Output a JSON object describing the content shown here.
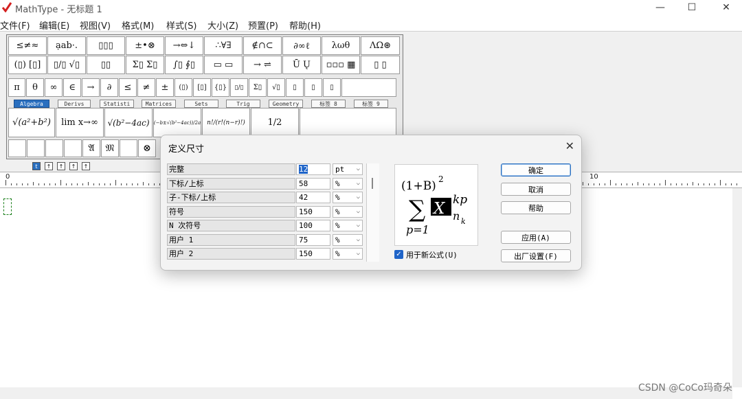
{
  "window": {
    "title": "MathType - 无标题 1",
    "minimize_glyph": "—",
    "maximize_glyph": "☐",
    "close_glyph": "✕"
  },
  "menu": [
    "文件(F)",
    "编辑(E)",
    "视图(V)",
    "格式(M)",
    "样式(S)",
    "大小(Z)",
    "预置(P)",
    "帮助(H)"
  ],
  "palette": {
    "row1": [
      "≤≠≈",
      "ạab·.",
      "▯▯▯",
      "±•⊗",
      "→⇔↓",
      "∴∀∃",
      "∉∩⊂",
      "∂∞ℓ",
      "λωθ",
      "ΛΩ⊛"
    ],
    "row2": [
      "(▯) [▯]",
      "▯/▯ √▯",
      "▯▯",
      "Σ▯ Σ▯",
      "∫▯ ∮▯",
      "▭ ▭",
      "→ ⇌",
      "Ū Ų",
      "▫▫▫ ▦",
      "▯ ▯"
    ],
    "row3": [
      "π",
      "θ",
      "∞",
      "∈",
      "→",
      "∂",
      "≤",
      "≠",
      "±",
      "(▯)",
      "[▯]",
      "{▯}",
      "▯/▯",
      "Σ▯",
      "√▯",
      "▯",
      "▯",
      "▯"
    ],
    "tabs": [
      "Algebra",
      "Derivs",
      "Statisti",
      "Matrices",
      "Sets",
      "Trig",
      "Geometry",
      "标签 8",
      "标签 9"
    ],
    "templates": [
      "√(a²+b²)",
      "lim x→∞",
      "√(b²−4ac)",
      "(−b±√(b²−4ac))/2a",
      "n!/(r!(n−r)!)",
      "1/2"
    ],
    "row5": [
      "𝔄",
      "𝔐",
      "⊗"
    ],
    "nav": [
      "t",
      "↑",
      "↑",
      "↑",
      "↑"
    ]
  },
  "ruler": {
    "labels": [
      "0",
      "10"
    ]
  },
  "dialog": {
    "title": "定义尺寸",
    "close": "✕",
    "rows": [
      {
        "label": "完整",
        "value": "12",
        "unit": "pt"
      },
      {
        "label": "下标/上标",
        "value": "58",
        "unit": "%"
      },
      {
        "label": "子-下标/上标",
        "value": "42",
        "unit": "%"
      },
      {
        "label": "符号",
        "value": "150",
        "unit": "%"
      },
      {
        "label": "N 次符号",
        "value": "100",
        "unit": "%"
      },
      {
        "label": "用户 1",
        "value": "75",
        "unit": "%"
      },
      {
        "label": "用户 2",
        "value": "150",
        "unit": "%"
      }
    ],
    "chevron": "⌵",
    "preview": {
      "base_open": "(1+B)",
      "exponent": "2",
      "sum": "∑",
      "x": "X",
      "sup": "kp",
      "sub": "n",
      "subsub": "k",
      "lower": "p=1"
    },
    "buttons": {
      "ok": "确定",
      "cancel": "取消",
      "help": "帮助",
      "apply": "应用(A)",
      "factory": "出厂设置(F)"
    },
    "checkbox_label": "用于新公式(U)",
    "checkbox_checked": true
  },
  "watermark": "CSDN @CoCo玛奇朵"
}
